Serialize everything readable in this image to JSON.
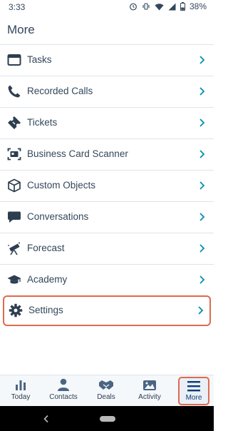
{
  "status": {
    "time": "3:33",
    "battery": "38%"
  },
  "header": {
    "title": "More"
  },
  "menu": [
    {
      "label": "Tasks",
      "icon": "tasks-icon"
    },
    {
      "label": "Recorded Calls",
      "icon": "phone-icon"
    },
    {
      "label": "Tickets",
      "icon": "ticket-icon"
    },
    {
      "label": "Business Card Scanner",
      "icon": "scanner-icon"
    },
    {
      "label": "Custom Objects",
      "icon": "cube-icon"
    },
    {
      "label": "Conversations",
      "icon": "chat-bubble-icon"
    },
    {
      "label": "Forecast",
      "icon": "telescope-icon"
    },
    {
      "label": "Academy",
      "icon": "graduation-cap-icon"
    },
    {
      "label": "Settings",
      "icon": "gear-icon",
      "selected": true
    }
  ],
  "bottom_nav": [
    {
      "label": "Today",
      "icon": "bar-chart-icon"
    },
    {
      "label": "Contacts",
      "icon": "person-icon"
    },
    {
      "label": "Deals",
      "icon": "handshake-icon"
    },
    {
      "label": "Activity",
      "icon": "activity-image-icon"
    },
    {
      "label": "More",
      "icon": "hamburger-icon",
      "active": true
    }
  ],
  "colors": {
    "text": "#33475b",
    "chevron": "#0091ae",
    "highlight": "#e06a4e",
    "nav_active_bg": "#eaf0f6"
  }
}
